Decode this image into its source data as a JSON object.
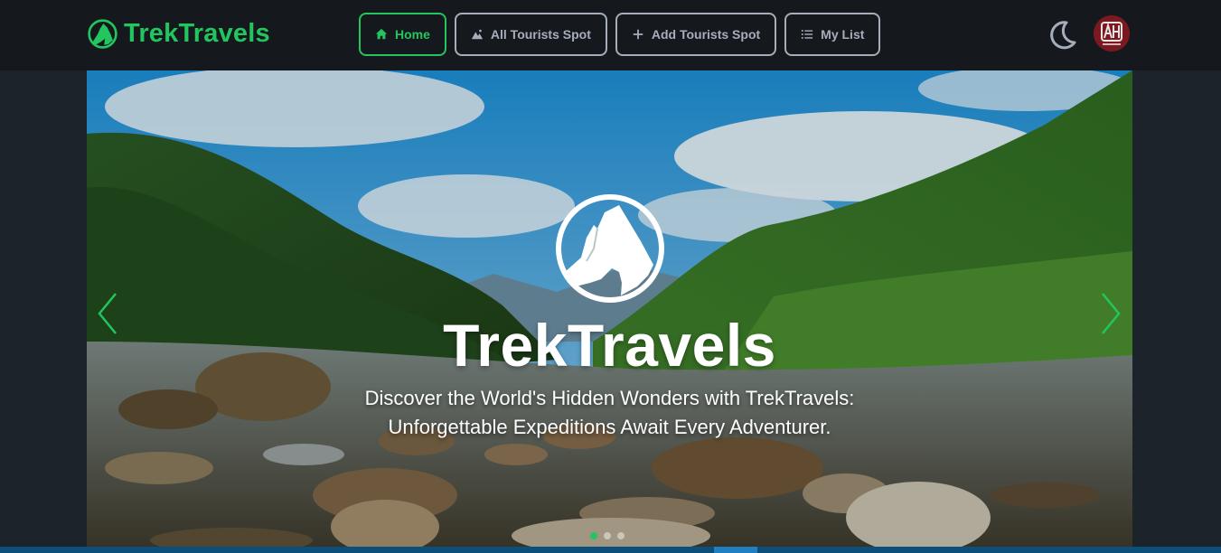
{
  "brand": {
    "name": "TrekTravels",
    "logo_icon": "mountain-logo-icon",
    "color": "#22c55e"
  },
  "nav": {
    "items": [
      {
        "label": "Home",
        "icon": "home-icon",
        "active": true
      },
      {
        "label": "All Tourists Spot",
        "icon": "mountain-icon",
        "active": false
      },
      {
        "label": "Add Tourists Spot",
        "icon": "plus-icon",
        "active": false
      },
      {
        "label": "My List",
        "icon": "list-icon",
        "active": false
      }
    ]
  },
  "header_right": {
    "theme_icon": "moon-icon",
    "avatar_icon": "user-avatar-icon"
  },
  "hero": {
    "title": "TrekTravels",
    "subtitle_line1": "Discover the World's Hidden Wonders with TrekTravels:",
    "subtitle_line2": "Unforgettable Expeditions Await Every Adventurer.",
    "slide_count": 3,
    "active_slide": 1,
    "prev_icon": "chevron-left-icon",
    "next_icon": "chevron-right-icon"
  },
  "colors": {
    "accent": "#22c55e",
    "navbar": "#15191e",
    "page": "#1d232a",
    "muted": "#a6adbb"
  }
}
